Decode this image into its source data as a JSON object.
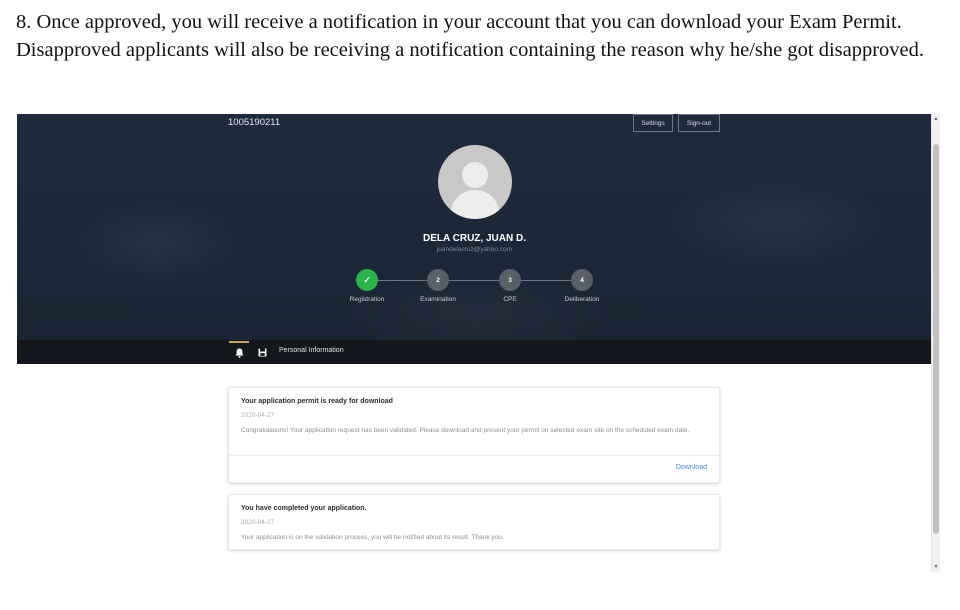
{
  "document": {
    "paragraph": "8. Once approved, you will receive a notification in your account that you can download your Exam Permit. Disapproved applicants will also be receiving a notification containing the reason why he/she got disapproved."
  },
  "header": {
    "account_id": "1005190211",
    "settings_label": "Settings",
    "signout_label": "Sign-out"
  },
  "profile": {
    "name": "DELA CRUZ, JUAN D.",
    "email": "juandelacruz@yahoo.com"
  },
  "steps": [
    {
      "label": "Registration",
      "marker": "✓",
      "status": "complete"
    },
    {
      "label": "Examination",
      "marker": "2",
      "status": "pending"
    },
    {
      "label": "CPE",
      "marker": "3",
      "status": "pending"
    },
    {
      "label": "Deliberation",
      "marker": "4",
      "status": "pending"
    }
  ],
  "tabs": {
    "notifications_icon": "bell-icon",
    "save_icon": "floppy-disk-icon",
    "personal_info_label": "Personal Information"
  },
  "notifications": [
    {
      "title": "Your application permit is ready for download",
      "date": "2020-04-27",
      "body": "Congratulations! Your application request has been validated. Please download and present your permit on selected exam site on the scheduled exam date.",
      "action_label": "Download"
    },
    {
      "title": "You have completed your application.",
      "date": "2020-04-27",
      "body": "Your application is on the validation process, you will be notified about its result. Thank you."
    }
  ],
  "colors": {
    "hero_background": "#1f2b3d",
    "step_complete": "#2bb34c",
    "step_pending": "#5a6068",
    "link": "#4a86e8"
  }
}
